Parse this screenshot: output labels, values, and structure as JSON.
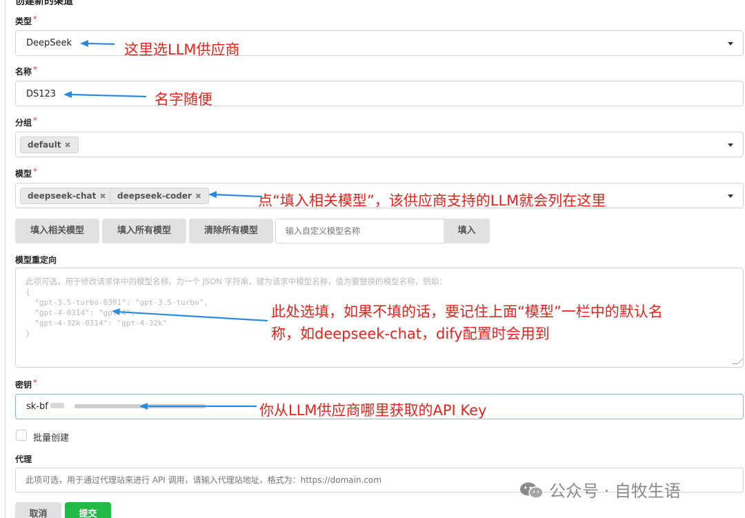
{
  "form": {
    "heading": "创建新的渠道",
    "type": {
      "label": "类型",
      "value": "DeepSeek"
    },
    "name": {
      "label": "名称",
      "value": "DS123"
    },
    "group": {
      "label": "分组",
      "chips": [
        "default"
      ]
    },
    "models": {
      "label": "模型",
      "chips": [
        "deepseek-chat",
        "deepseek-coder"
      ],
      "fill_related_label": "填入相关模型",
      "fill_all_label": "填入所有模型",
      "clear_all_label": "清除所有模型",
      "custom_placeholder": "输入自定义模型名称",
      "fill_label": "填入"
    },
    "mapping": {
      "label": "模型重定向",
      "placeholder_lines": [
        "此项可选，用于修改请求体中的模型名称，为一个 JSON 字符串，键为请求中模型名称，值为要替换的模型名称，例如：",
        "{",
        "  \"gpt-3.5-turbo-0301\": \"gpt-3.5-turbo\",",
        "  \"gpt-4-0314\": \"gpt-4\",",
        "  \"gpt-4-32k-0314\": \"gpt-4-32k\"",
        "}"
      ]
    },
    "key": {
      "label": "密钥",
      "value": "sk-bf"
    },
    "batch": {
      "label": "批量创建",
      "checked": false
    },
    "proxy": {
      "label": "代理",
      "placeholder": "此项可选，用于通过代理站来进行 API 调用，请输入代理站地址，格式为：https://domain.com"
    },
    "cancel_label": "取消",
    "submit_label": "提交"
  },
  "annotations": {
    "type_note": "这里选LLM供应商",
    "name_note": "名字随便",
    "models_note": "点“填入相关模型”，该供应商支持的LLM就会列在这里",
    "mapping_note_line1": "此处选填，如果不填的话，要记住上面“模型”一栏中的默认名",
    "mapping_note_line2": "称，如deepseek-chat，dify配置时会用到",
    "key_note": "你从LLM供应商哪里获取的API Key"
  },
  "watermark": "公众号 · 自牧生语",
  "colors": {
    "required": "#db2828",
    "annotation": "#e4231d",
    "arrow": "#2a8ae0",
    "submit": "#21ba45",
    "key_border": "#85b7d9"
  }
}
